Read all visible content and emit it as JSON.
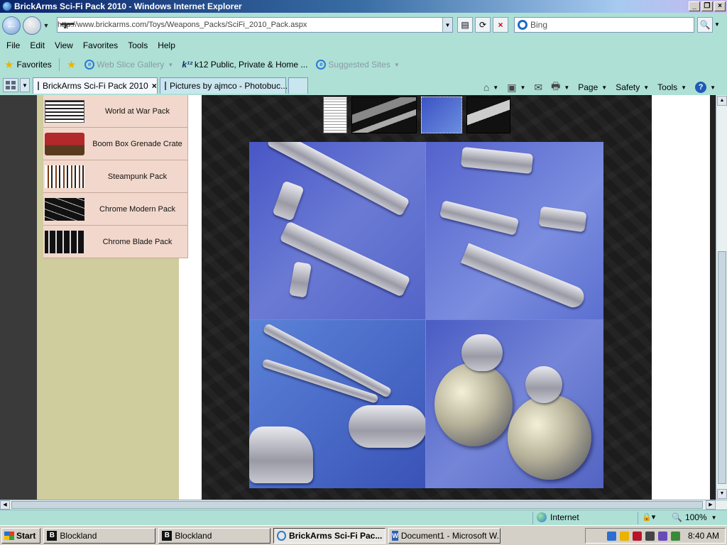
{
  "window": {
    "title": "BrickArms Sci-Fi Pack 2010 - Windows Internet Explorer"
  },
  "nav": {
    "url": "http://www.brickarms.com/Toys/Weapons_Packs/SciFi_2010_Pack.aspx",
    "search_value": "Bing"
  },
  "menu": [
    "File",
    "Edit",
    "View",
    "Favorites",
    "Tools",
    "Help"
  ],
  "favorites": {
    "label": "Favorites",
    "items": [
      "Web Slice Gallery",
      "k12 Public, Private & Home ...",
      "Suggested Sites"
    ]
  },
  "tabs": [
    {
      "label": "BrickArms Sci-Fi Pack 2010",
      "close": "×"
    },
    {
      "label": "Pictures by ajmco - Photobuc..."
    }
  ],
  "commands": {
    "page": "Page",
    "safety": "Safety",
    "tools": "Tools"
  },
  "products": [
    {
      "label": "World at War Pack"
    },
    {
      "label": "Boom Box Grenade Crate"
    },
    {
      "label": "Steampunk Pack"
    },
    {
      "label": "Chrome Modern Pack"
    },
    {
      "label": "Chrome Blade Pack"
    }
  ],
  "status": {
    "zone": "Internet",
    "zoom": "100%"
  },
  "taskbar": {
    "start": "Start",
    "buttons": [
      "Blockland",
      "Blockland",
      "BrickArms Sci-Fi Pac...",
      "Document1 - Microsoft W..."
    ],
    "clock": "8:40 AM"
  },
  "colors": {
    "chrome_bg": "#aee0d6",
    "title_gradient_start": "#0a246a",
    "sidebar": "#cfcc9e",
    "product_item": "#f2d8cc",
    "photo_blue": "#4856c6"
  }
}
